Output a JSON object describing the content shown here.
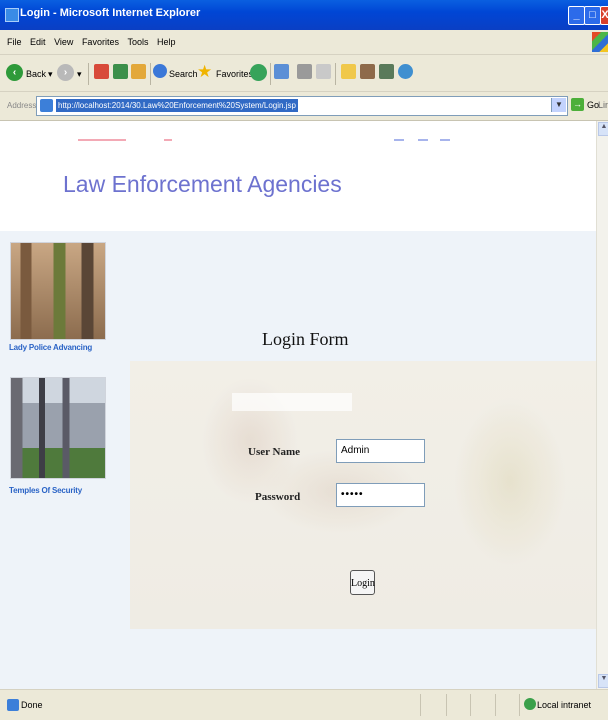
{
  "window": {
    "title": "Login - Microsoft Internet Explorer",
    "min_glyph": "_",
    "max_glyph": "□",
    "close_glyph": "X"
  },
  "menu": [
    "File",
    "Edit",
    "View",
    "Favorites",
    "Tools",
    "Help"
  ],
  "toolbar": {
    "back_label": "Back",
    "search_label": "Search",
    "favorites_label": "Favorites"
  },
  "address": {
    "label": "Address",
    "url": "http://localhost:2014/30.Law%20Enforcement%20System/Login.jsp",
    "go_label": "Go",
    "links_label": "Links"
  },
  "page": {
    "heading": "Law Enforcement Agencies",
    "sidebar": [
      {
        "caption": "Lady Police Advancing"
      },
      {
        "caption": "Temples Of Security"
      }
    ],
    "form": {
      "title": "Login Form",
      "username_label": "User Name",
      "username_value": "Admin",
      "password_label": "Password",
      "password_value": "•••••",
      "login_label": "Login"
    }
  },
  "status": {
    "text": "Done",
    "zone": "Local intranet"
  },
  "colors": {
    "heading": "#6d72cf",
    "caption": "#2b64c6",
    "content_bg": "#eef3f9",
    "chrome": "#ece9d8",
    "titlebar": "#0046d5"
  },
  "icons": [
    "ie-app-icon",
    "back-icon",
    "forward-icon",
    "stop-icon",
    "refresh-icon",
    "home-icon",
    "search-icon",
    "favorites-icon",
    "media-icon",
    "mail-icon",
    "print-icon",
    "edit-icon",
    "folder-icon",
    "messenger-icon",
    "go-icon",
    "windows-flag-icon"
  ]
}
